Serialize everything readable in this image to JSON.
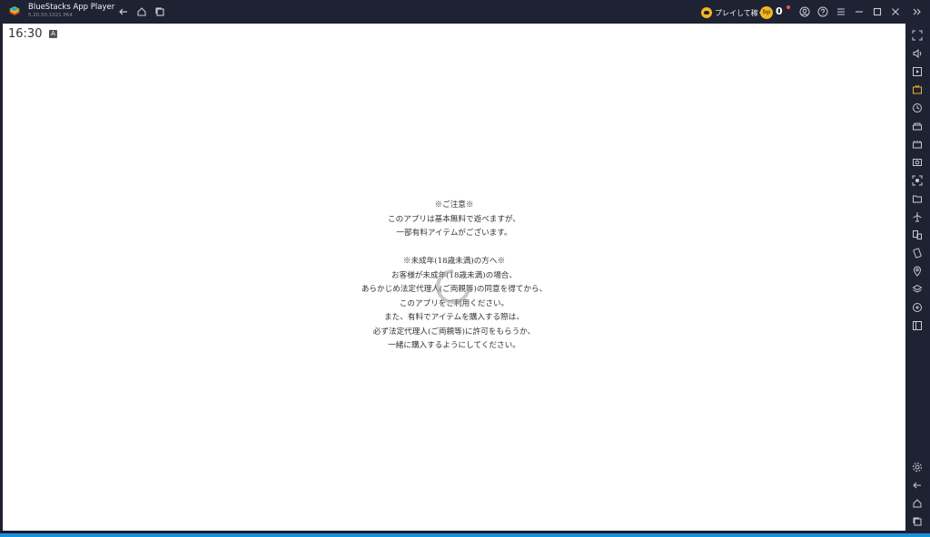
{
  "window": {
    "app_name": "BlueStacks App Player",
    "app_version": "5.20.50.1021 P64"
  },
  "titlebar": {
    "earn_label": "プレイして稼ぐ",
    "coin_icon_text": "bp",
    "coin_count": "0"
  },
  "status_bar": {
    "time": "16:30",
    "notification_badge": "A"
  },
  "notice": {
    "lines_1": [
      "※ご注意※",
      "このアプリは基本無料で遊べますが、",
      "一部有料アイテムがございます。"
    ],
    "lines_2": [
      "※未成年(18歳未満)の方へ※",
      "お客様が未成年(18歳未満)の場合、",
      "あらかじめ法定代理人(ご両親等)の同意を得てから、",
      "このアプリをご利用ください。",
      "また、有料でアイテムを購入する際は、",
      "必ず法定代理人(ご両親等)に許可をもらうか、",
      "一緒に購入するようにしてください。"
    ]
  },
  "colors": {
    "chrome_bg": "#1e2233",
    "desktop_blue": "#1a8fe0",
    "coin_gold": "#f4b521",
    "sidebar_accent": "#f4b521"
  },
  "icons": {
    "titlebar": [
      "back-arrow-icon",
      "home-icon",
      "multi-window-icon",
      "account-icon",
      "help-icon",
      "menu-icon",
      "minimize-icon",
      "maximize-icon",
      "close-icon",
      "collapse-sidebar-icon"
    ],
    "sidebar": [
      "fullscreen-icon",
      "volume-icon",
      "media-play-icon",
      "tv-icon",
      "rotate-icon",
      "shop-icon",
      "macro-icon",
      "screenshot-icon",
      "record-icon",
      "folder-icon",
      "airplane-icon",
      "multi-instance-icon",
      "shake-icon",
      "location-icon",
      "layers-icon",
      "eco-mode-icon",
      "sidebar-toggle-icon",
      "settings-icon",
      "back-icon",
      "home-icon",
      "recent-apps-icon"
    ]
  }
}
